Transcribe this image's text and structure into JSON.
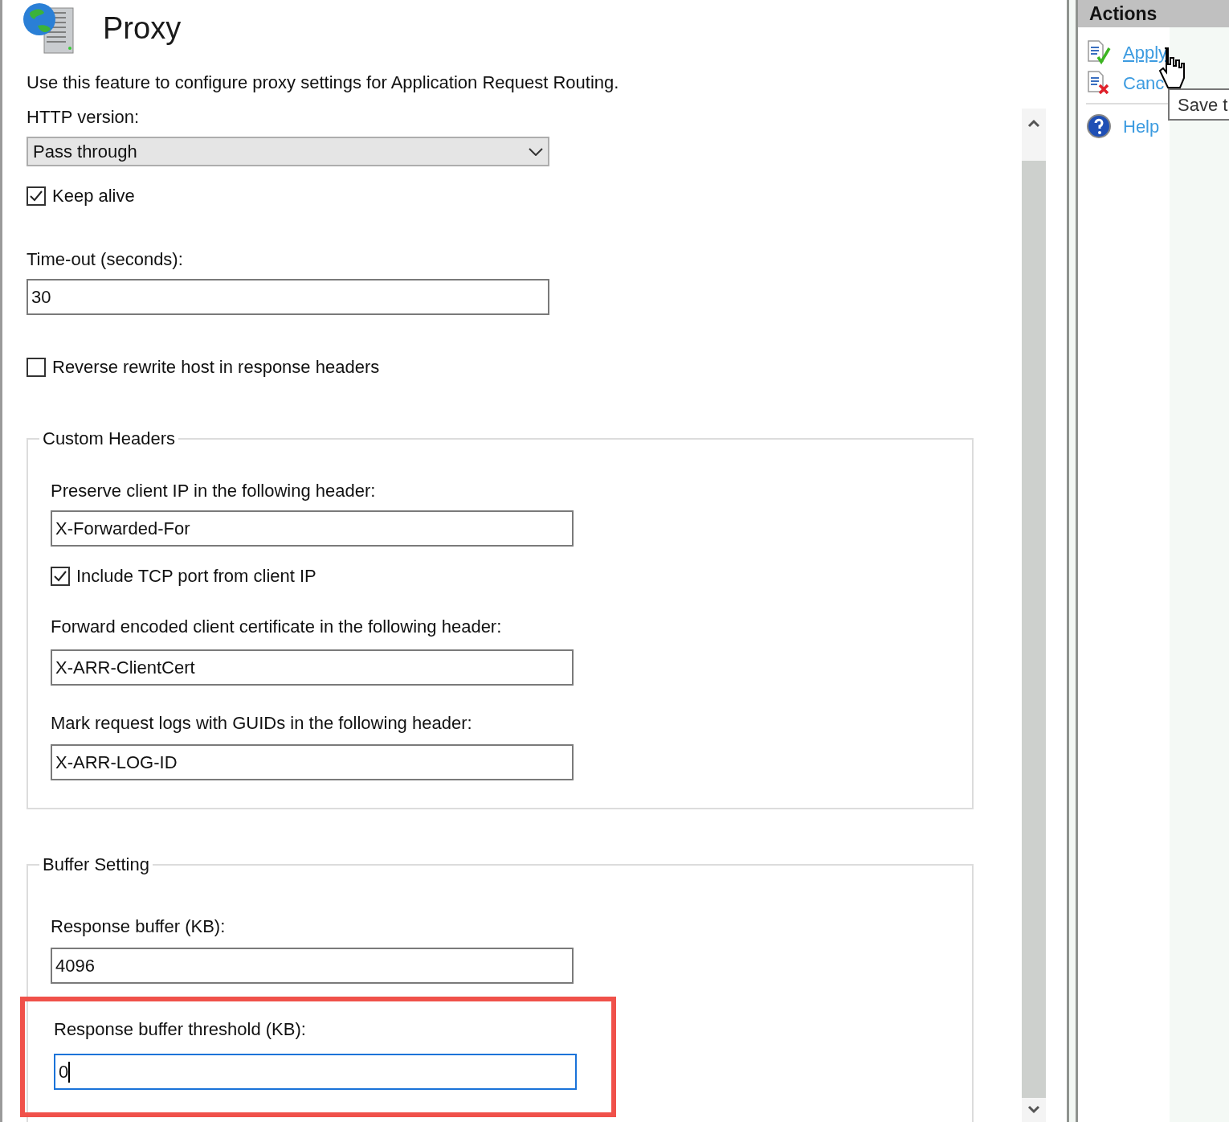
{
  "header": {
    "title": "Proxy"
  },
  "description": "Use this feature to configure proxy settings for Application Request Routing.",
  "http_version": {
    "label": "HTTP version:",
    "value": "Pass through"
  },
  "keep_alive": {
    "label": "Keep alive",
    "checked": true
  },
  "timeout": {
    "label": "Time-out (seconds):",
    "value": "30"
  },
  "reverse_rewrite": {
    "label": "Reverse rewrite host in response headers",
    "checked": false
  },
  "custom_headers": {
    "title": "Custom Headers",
    "preserve_ip": {
      "label": "Preserve client IP in the following header:",
      "value": "X-Forwarded-For"
    },
    "include_port": {
      "label": "Include TCP port from client IP",
      "checked": true
    },
    "client_cert": {
      "label": "Forward encoded client certificate in the following header:",
      "value": "X-ARR-ClientCert"
    },
    "log_guid": {
      "label": "Mark request logs with GUIDs in the following header:",
      "value": "X-ARR-LOG-ID"
    }
  },
  "buffer_setting": {
    "title": "Buffer Setting",
    "response_buffer": {
      "label": "Response buffer (KB):",
      "value": "4096"
    },
    "threshold": {
      "label": "Response buffer threshold (KB):",
      "value": "0",
      "focused": true,
      "highlighted": true
    }
  },
  "actions": {
    "title": "Actions",
    "items": [
      {
        "kind": "apply",
        "label": "Apply",
        "hovered": true
      },
      {
        "kind": "cancel",
        "label": "Canc",
        "hovered": false
      },
      {
        "kind": "help",
        "label": "Help",
        "hovered": false
      }
    ],
    "tooltip": "Save t"
  }
}
